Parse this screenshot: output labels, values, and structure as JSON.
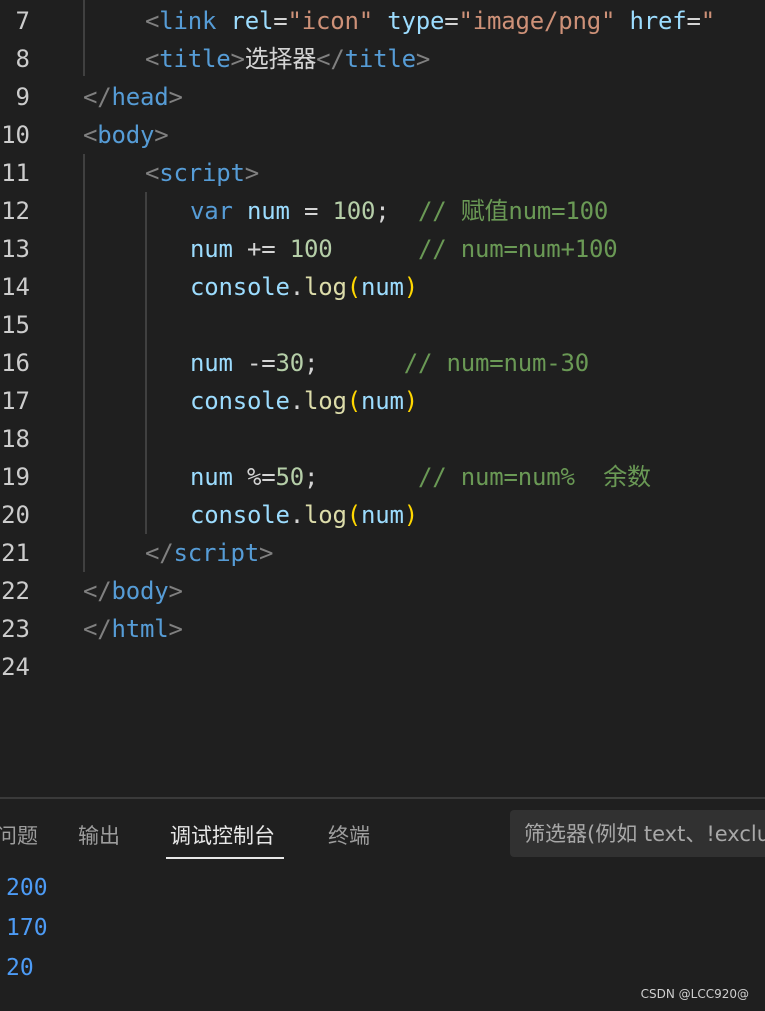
{
  "editor": {
    "lines": [
      {
        "number": "7",
        "tokens": [
          {
            "t": "<",
            "c": "c-pun"
          },
          {
            "t": "link",
            "c": "c-tag"
          },
          {
            "t": " ",
            "c": "c-txt"
          },
          {
            "t": "rel",
            "c": "c-attr"
          },
          {
            "t": "=",
            "c": "c-txt"
          },
          {
            "t": "\"icon\"",
            "c": "c-str"
          },
          {
            "t": " ",
            "c": "c-txt"
          },
          {
            "t": "type",
            "c": "c-attr"
          },
          {
            "t": "=",
            "c": "c-txt"
          },
          {
            "t": "\"image/png\"",
            "c": "c-str"
          },
          {
            "t": " ",
            "c": "c-txt"
          },
          {
            "t": "href",
            "c": "c-attr"
          },
          {
            "t": "=",
            "c": "c-txt"
          },
          {
            "t": "\"",
            "c": "c-str"
          }
        ]
      },
      {
        "number": "8",
        "tokens": [
          {
            "t": "<",
            "c": "c-pun"
          },
          {
            "t": "title",
            "c": "c-tag"
          },
          {
            "t": ">",
            "c": "c-pun"
          },
          {
            "t": "选择器",
            "c": "c-txt cjk"
          },
          {
            "t": "</",
            "c": "c-pun"
          },
          {
            "t": "title",
            "c": "c-tag"
          },
          {
            "t": ">",
            "c": "c-pun"
          }
        ]
      },
      {
        "number": "9",
        "tokens": [
          {
            "t": "</",
            "c": "c-pun"
          },
          {
            "t": "head",
            "c": "c-tag"
          },
          {
            "t": ">",
            "c": "c-pun"
          }
        ]
      },
      {
        "number": "10",
        "tokens": [
          {
            "t": "<",
            "c": "c-pun"
          },
          {
            "t": "body",
            "c": "c-tag"
          },
          {
            "t": ">",
            "c": "c-pun"
          }
        ]
      },
      {
        "number": "11",
        "tokens": [
          {
            "t": "<",
            "c": "c-pun"
          },
          {
            "t": "script",
            "c": "c-tag"
          },
          {
            "t": ">",
            "c": "c-pun"
          }
        ]
      },
      {
        "number": "12",
        "tokens": [
          {
            "t": "var",
            "c": "c-kw"
          },
          {
            "t": " ",
            "c": "c-txt"
          },
          {
            "t": "num",
            "c": "c-var"
          },
          {
            "t": " = ",
            "c": "c-op"
          },
          {
            "t": "100",
            "c": "c-num"
          },
          {
            "t": ";",
            "c": "c-op"
          },
          {
            "t": "  // ",
            "c": "c-com"
          },
          {
            "t": "赋值",
            "c": "c-com cjk"
          },
          {
            "t": "num=100",
            "c": "c-com"
          }
        ]
      },
      {
        "number": "13",
        "tokens": [
          {
            "t": "num",
            "c": "c-var"
          },
          {
            "t": " += ",
            "c": "c-op"
          },
          {
            "t": "100",
            "c": "c-num"
          },
          {
            "t": "      // num=num+100",
            "c": "c-com"
          }
        ]
      },
      {
        "number": "14",
        "tokens": [
          {
            "t": "console",
            "c": "c-var"
          },
          {
            "t": ".",
            "c": "c-op"
          },
          {
            "t": "log",
            "c": "c-fn"
          },
          {
            "t": "(",
            "c": "c-par"
          },
          {
            "t": "num",
            "c": "c-var"
          },
          {
            "t": ")",
            "c": "c-par"
          }
        ]
      },
      {
        "number": "15",
        "tokens": []
      },
      {
        "number": "16",
        "tokens": [
          {
            "t": "num",
            "c": "c-var"
          },
          {
            "t": " -=",
            "c": "c-op"
          },
          {
            "t": "30",
            "c": "c-num"
          },
          {
            "t": ";",
            "c": "c-op"
          },
          {
            "t": "      // num=num-30",
            "c": "c-com"
          }
        ]
      },
      {
        "number": "17",
        "tokens": [
          {
            "t": "console",
            "c": "c-var"
          },
          {
            "t": ".",
            "c": "c-op"
          },
          {
            "t": "log",
            "c": "c-fn"
          },
          {
            "t": "(",
            "c": "c-par"
          },
          {
            "t": "num",
            "c": "c-var"
          },
          {
            "t": ")",
            "c": "c-par"
          }
        ]
      },
      {
        "number": "18",
        "tokens": []
      },
      {
        "number": "19",
        "tokens": [
          {
            "t": "num",
            "c": "c-var"
          },
          {
            "t": " %=",
            "c": "c-op"
          },
          {
            "t": "50",
            "c": "c-num"
          },
          {
            "t": ";",
            "c": "c-op"
          },
          {
            "t": "       // num=num%  ",
            "c": "c-com"
          },
          {
            "t": "余数",
            "c": "c-com cjk"
          }
        ]
      },
      {
        "number": "20",
        "tokens": [
          {
            "t": "console",
            "c": "c-var"
          },
          {
            "t": ".",
            "c": "c-op"
          },
          {
            "t": "log",
            "c": "c-fn"
          },
          {
            "t": "(",
            "c": "c-par"
          },
          {
            "t": "num",
            "c": "c-var"
          },
          {
            "t": ")",
            "c": "c-par"
          }
        ]
      },
      {
        "number": "21",
        "tokens": [
          {
            "t": "</",
            "c": "c-pun"
          },
          {
            "t": "script",
            "c": "c-tag"
          },
          {
            "t": ">",
            "c": "c-pun"
          }
        ]
      },
      {
        "number": "22",
        "tokens": [
          {
            "t": "</",
            "c": "c-pun"
          },
          {
            "t": "body",
            "c": "c-tag"
          },
          {
            "t": ">",
            "c": "c-pun"
          }
        ]
      },
      {
        "number": "23",
        "tokens": [
          {
            "t": "</",
            "c": "c-pun"
          },
          {
            "t": "html",
            "c": "c-tag"
          },
          {
            "t": ">",
            "c": "c-pun"
          }
        ]
      },
      {
        "number": "24",
        "tokens": []
      }
    ]
  },
  "panel": {
    "tabs": {
      "problems": "问题",
      "output": "输出",
      "debug_console": "调试控制台",
      "terminal": "终端"
    },
    "active_tab": "debug_console",
    "filter_placeholder": "筛选器(例如 text、!exclude)",
    "console_output": [
      "200",
      "170",
      "20"
    ]
  },
  "watermark": "CSDN @LCC920@",
  "colors": {
    "background": "#1f1f1f",
    "tag": "#569cd6",
    "attribute": "#9cdcfe",
    "string": "#ce9178",
    "number": "#b5cea8",
    "comment": "#6a9955",
    "function": "#dcdcaa",
    "bracket": "#ffd700",
    "console_value": "#4d9bf5"
  }
}
